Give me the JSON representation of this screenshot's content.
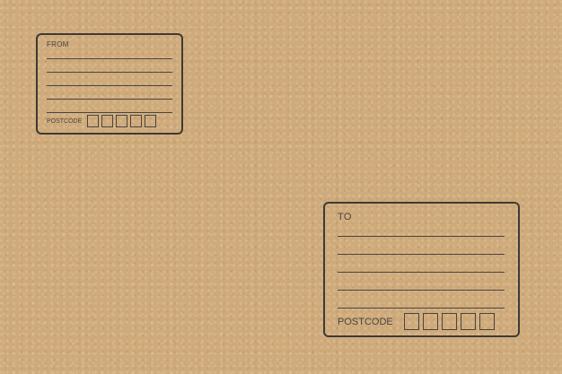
{
  "from_label": {
    "heading": "FROM",
    "postcode_label": "POSTCODE",
    "line_count": 5,
    "postcode_box_count": 5
  },
  "to_label": {
    "heading": "TO",
    "postcode_label": "POSTCODE",
    "line_count": 5,
    "postcode_box_count": 5
  },
  "colors": {
    "paper": "#cfab7c",
    "ink": "#3e3a36"
  }
}
